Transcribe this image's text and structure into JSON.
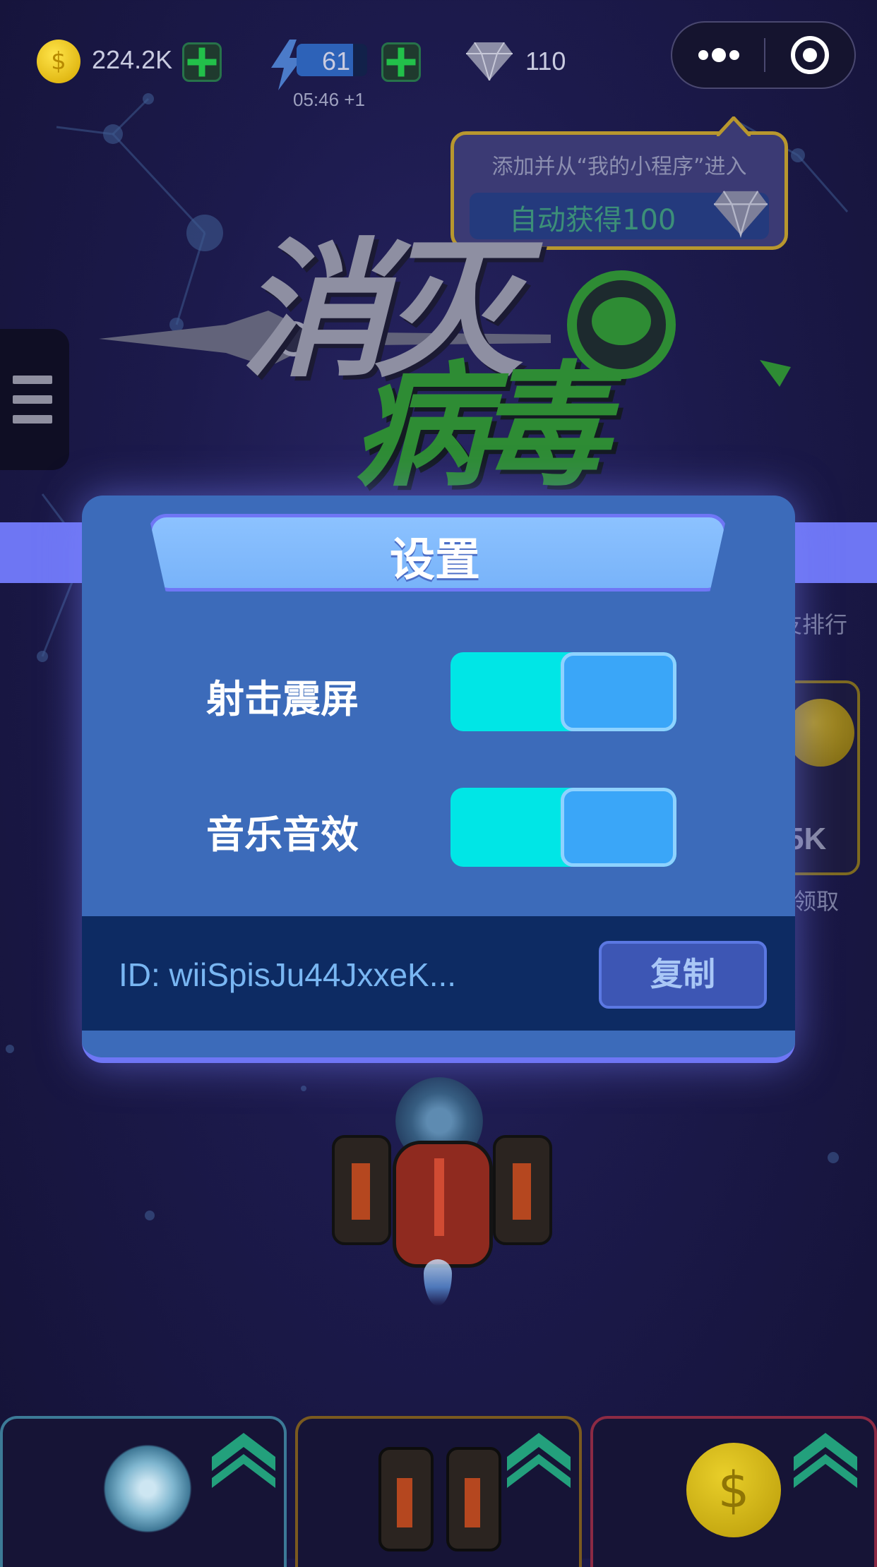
{
  "top_bar": {
    "coins": "224.2K",
    "energy": "61",
    "energy_timer": "05:46 +1",
    "gems": "110"
  },
  "tooltip": {
    "line1": "添加并从“我的小程序”进入",
    "line2": "自动获得100"
  },
  "game_title": {
    "line1": "消灭",
    "line2": "病毒"
  },
  "settings": {
    "title": "设置",
    "rows": [
      {
        "label": "射击震屏",
        "enabled": true
      },
      {
        "label": "音乐音效",
        "enabled": true
      }
    ],
    "user_id": "ID: wiiSpisJu44JxxeK...",
    "copy_label": "复制"
  },
  "background_side": {
    "rank_label": "好友排行",
    "reward_value": "5K",
    "claim_label": "领取"
  },
  "colors": {
    "modal": "#3c6bba",
    "toggle_on": "#00e6e6",
    "knob": "#3aa6f8",
    "band": "#6e76f3",
    "copy_button": "#3d56b4"
  }
}
